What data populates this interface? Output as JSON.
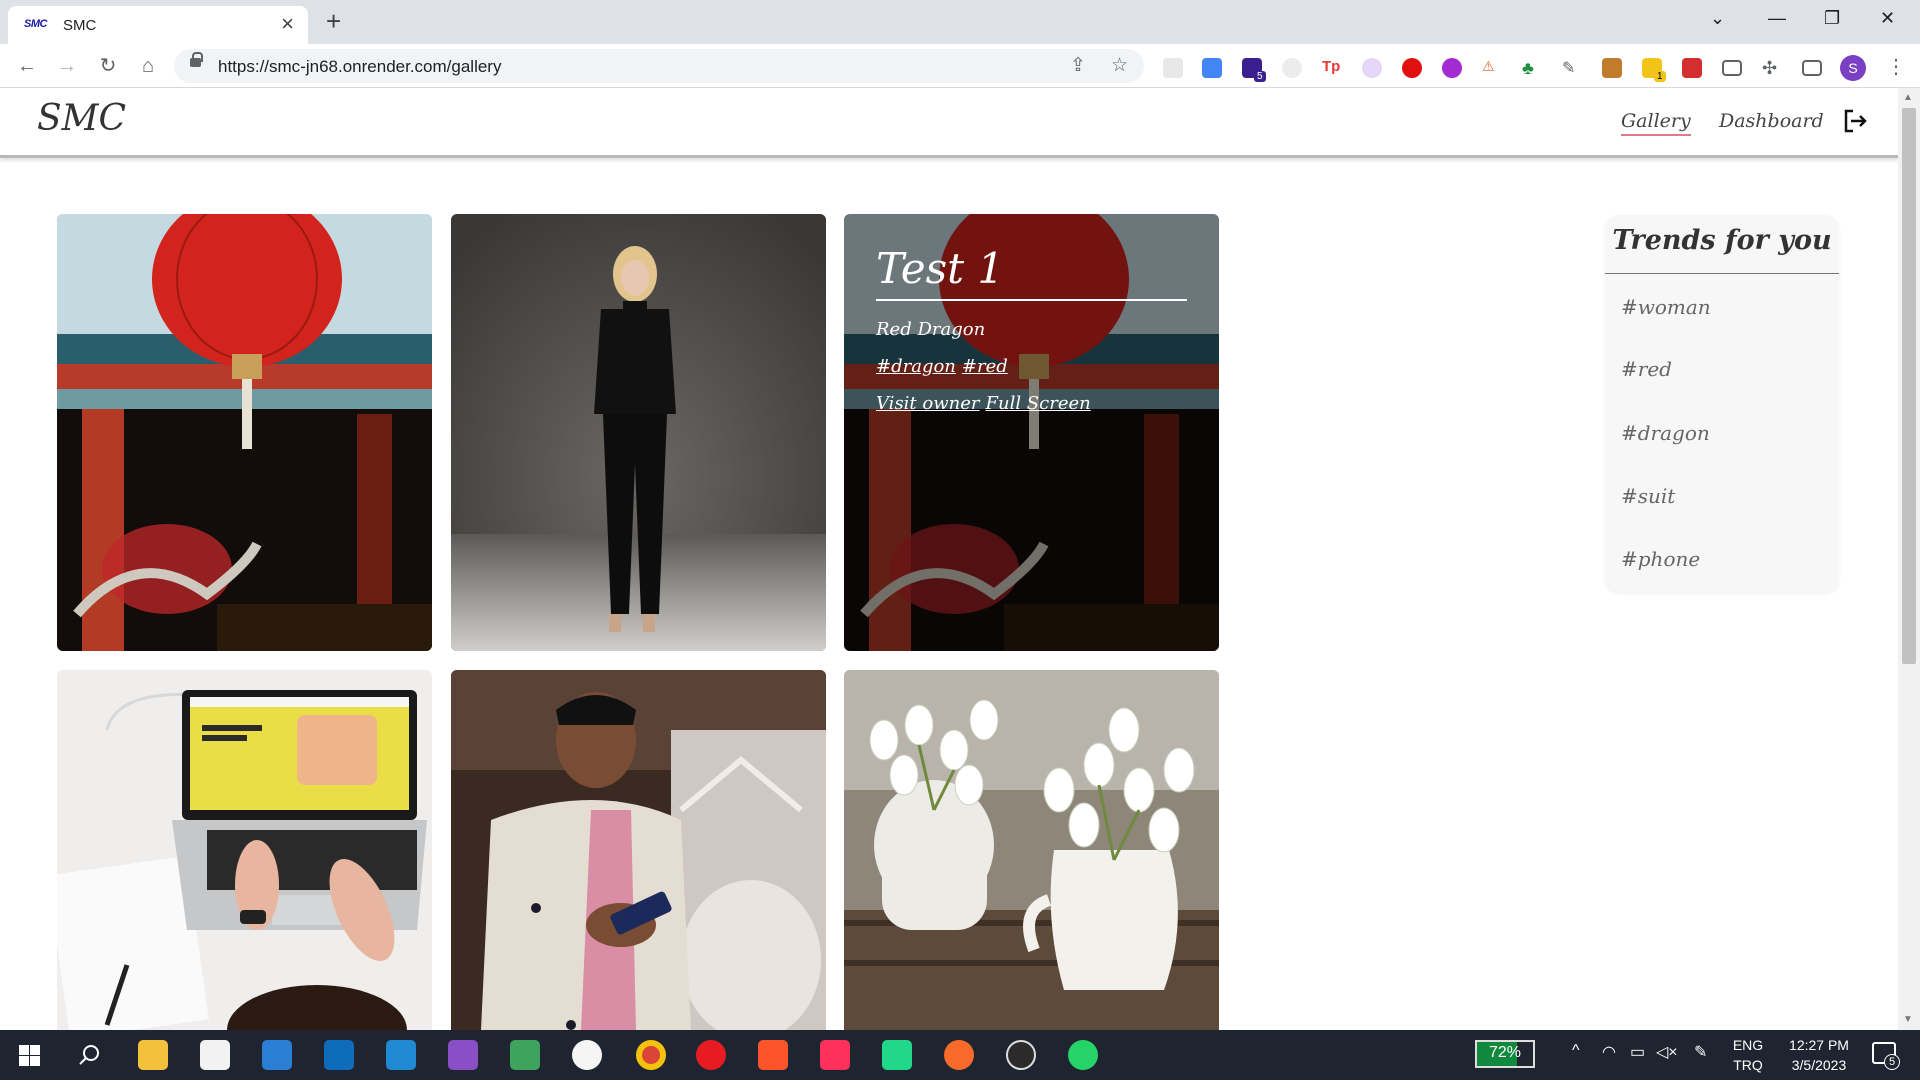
{
  "browser": {
    "tab_title": "SMC",
    "favicon_text": "SMC",
    "url": "https://smc-jn68.onrender.com/gallery",
    "profile_initial": "S",
    "extension_badges": [
      "5",
      "1"
    ]
  },
  "app": {
    "logo": "SMC",
    "nav": {
      "gallery": "Gallery",
      "dashboard": "Dashboard"
    },
    "logout_icon": "logout-icon"
  },
  "gallery": {
    "hover_card": {
      "title": "Test 1",
      "description": "Red Dragon",
      "tags": [
        "#dragon",
        "#red"
      ],
      "links": [
        "Visit owner",
        "Full Screen"
      ]
    },
    "photos": [
      {
        "subject": "red lantern and dragon temple"
      },
      {
        "subject": "woman in black suit"
      },
      {
        "subject": "red lantern and dragon temple"
      },
      {
        "subject": "laptop on desk"
      },
      {
        "subject": "man with phone"
      },
      {
        "subject": "white snowdrop flowers in jugs"
      }
    ]
  },
  "trends": {
    "title": "Trends for you",
    "items": [
      "#woman",
      "#red",
      "#dragon",
      "#suit",
      "#phone"
    ]
  },
  "taskbar": {
    "battery": "72%",
    "lang_top": "ENG",
    "lang_bottom": "TRQ",
    "time": "12:27 PM",
    "date": "3/5/2023",
    "notifications": "5"
  },
  "colors": {
    "accent_underline": "#e07a8a",
    "taskbar_bg": "#1f2530",
    "battery_green": "#10893e"
  }
}
